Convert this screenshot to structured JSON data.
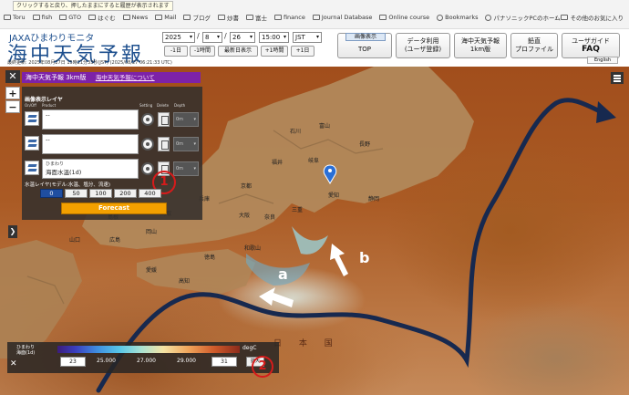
{
  "bookmarks": {
    "tooltip": "クリックすると戻り、押したままにすると履歴が表示されます",
    "items": [
      "Toru",
      "fish",
      "GTO",
      "はぐむ",
      "News",
      "Mail",
      "ブログ",
      "炒書",
      "富士",
      "finance",
      "Journal Database",
      "Online course",
      "Bookmarks",
      "パナソニックPCのホーム..."
    ],
    "right": "その他のお気に入り"
  },
  "header": {
    "brand_sub": "JAXAひまわりモニタ",
    "brand_main": "海中天気予報",
    "last_update": "最終更新: 2025年08月27日 15時21分33秒(JST) (2025/08/27 06:21:33 UTC)",
    "year": "2025",
    "month": "8",
    "day": "26",
    "time": "15:00",
    "tz": "JST",
    "btn_minus_day": "-1日",
    "btn_minus_hour": "-1時間",
    "btn_latest": "最新日表示",
    "btn_plus_hour": "+1時間",
    "btn_plus_day": "+1日",
    "nav_image_tag": "画像表示",
    "nav_top": "TOP",
    "nav_data_l1": "データ利用",
    "nav_data_l2": "(ユーザ登録)",
    "nav_forecast_l1": "海中天気予報",
    "nav_forecast_l2": "1km版",
    "nav_profile_l1": "鉛直",
    "nav_profile_l2": "プロファイル",
    "nav_guide_l1": "ユーザガイド",
    "nav_guide_l2": "FAQ",
    "english": "English"
  },
  "map": {
    "title": "海中天気予報 3km版",
    "title_link": "海中天気予報について",
    "zoom_in": "+",
    "zoom_out": "−",
    "close": "✕",
    "expand": "❯",
    "sea_label": "日 本 国",
    "annotation_a": "a",
    "annotation_b": "b"
  },
  "panel": {
    "heading": "画像表示レイヤ",
    "col_onoff": "On/Off",
    "col_product": "Product",
    "col_setting": "Setting",
    "col_delete": "Delete",
    "col_depth": "Depth",
    "layers": [
      {
        "line1": "--",
        "line2": "",
        "depth": "0m"
      },
      {
        "line1": "--",
        "line2": "",
        "depth": "0m"
      },
      {
        "line1": "ひまわり",
        "line2": "海面水温(1d)",
        "depth": "0m"
      }
    ],
    "water_layer_label": "水温レイヤ(モデル:水温、塩分、流速)",
    "depths": [
      "0",
      "50",
      "100",
      "200",
      "400"
    ],
    "forecast": "Forecast",
    "marker1": "1"
  },
  "legend": {
    "label_line1": "ひまわり",
    "label_line2": "海面(1d)",
    "unit": "degC",
    "min": "23",
    "max": "31",
    "ticks": [
      "25.000",
      "27.000",
      "29.000"
    ],
    "extra": "拡大",
    "marker2": "2",
    "close": "✕"
  },
  "prefectures": [
    "石川",
    "富山",
    "福井",
    "岐阜",
    "長野",
    "愛知",
    "静岡",
    "三重",
    "奈良",
    "京都",
    "兵庫",
    "大阪",
    "和歌山",
    "徳島",
    "高知",
    "愛媛",
    "広島",
    "山口",
    "岡山",
    "鳥取",
    "島根"
  ],
  "colors": {
    "brand_blue": "#1d4f8e",
    "title_purple": "#7d22a8",
    "forecast_orange": "#f3a000",
    "active_depth": "#1f4ea1",
    "kuroshio_arrow": "#17294f",
    "marker_red": "#d61b1b"
  }
}
